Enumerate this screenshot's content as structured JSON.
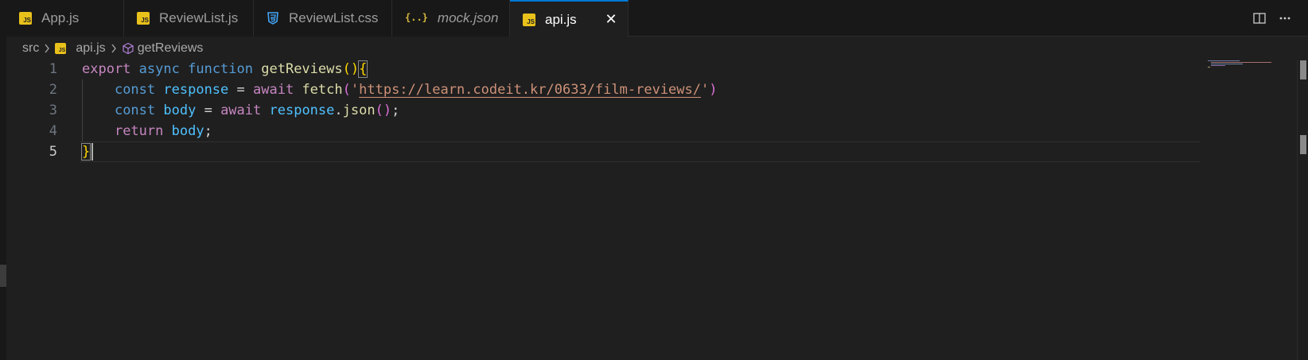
{
  "tabs": [
    {
      "label": "App.js",
      "icon": "js-file-icon",
      "italic": false
    },
    {
      "label": "ReviewList.js",
      "icon": "js-file-icon",
      "italic": false
    },
    {
      "label": "ReviewList.css",
      "icon": "css-file-icon",
      "italic": false
    },
    {
      "label": "mock.json",
      "icon": "json-file-icon",
      "italic": true
    },
    {
      "label": "api.js",
      "icon": "js-file-icon",
      "italic": false,
      "active": true
    }
  ],
  "icons": {
    "js_badge": "JS",
    "json_badge": "{..}",
    "close": "✕"
  },
  "toolbar": {
    "split_editor": "split-editor-icon",
    "more_actions": "ellipsis-icon"
  },
  "breadcrumb": {
    "folder": "src",
    "file": "api.js",
    "symbol": "getReviews"
  },
  "line_numbers": [
    "1",
    "2",
    "3",
    "4",
    "5"
  ],
  "code": {
    "l1": {
      "export": "export",
      "async": "async",
      "function": "function",
      "name": "getReviews",
      "paren_open": "(",
      "paren_close": ")",
      "brace": "{"
    },
    "l2": {
      "indent": "    ",
      "const": "const",
      "var": "response",
      "eq": " = ",
      "await": "await",
      "fetch": "fetch",
      "po": "(",
      "q1": "'",
      "url": "https://learn.codeit.kr/0633/film-reviews/",
      "q2": "'",
      "pc": ")"
    },
    "l3": {
      "indent": "    ",
      "const": "const",
      "var": "body",
      "eq": " = ",
      "await": "await",
      "obj": "response",
      "dot": ".",
      "method": "json",
      "po": "(",
      "pc": ")",
      "semi": ";"
    },
    "l4": {
      "indent": "    ",
      "return": "return",
      "var": "body",
      "semi": ";"
    },
    "l5": {
      "brace": "}"
    }
  },
  "colors": {
    "accent": "#0078d4",
    "keyword": "#569cd6",
    "control": "#c586c0",
    "function": "#dcdcaa",
    "variable": "#9cdcfe",
    "string": "#ce9178",
    "bracket1": "#ffd700",
    "bracket2": "#da70d6"
  }
}
